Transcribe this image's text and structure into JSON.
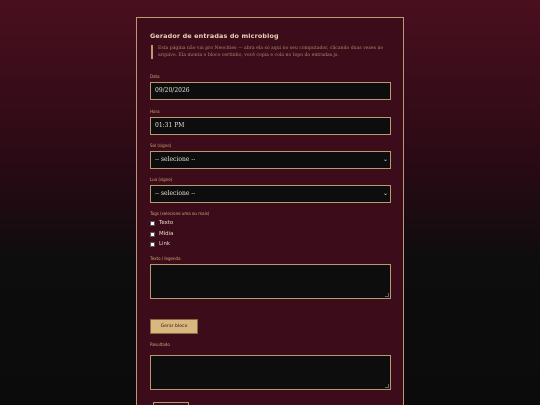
{
  "form": {
    "title": "Gerador de entradas do microblog",
    "note": "Esta página não vai pro Neocities — abra ela só aqui no seu computador, clicando duas vezes no arquivo. Ela monta o bloco certinho, você copia e cola no topo do entradas.js.",
    "date": {
      "label": "Data",
      "value": "09/20/2026"
    },
    "time": {
      "label": "Hora",
      "value": "01:31 PM"
    },
    "sun": {
      "label": "Sol (signo)",
      "selected": "-- selecione --"
    },
    "moon": {
      "label": "Lua (signo)",
      "selected": "-- selecione --"
    },
    "tags": {
      "label": "Tags (selecione uma ou mais)",
      "options": [
        "Texto",
        "Mídia",
        "Link"
      ]
    },
    "text": {
      "label": "Texto / legenda",
      "value": ""
    },
    "generate_label": "Gerar bloco",
    "result": {
      "label": "Resultado",
      "value": ""
    }
  }
}
